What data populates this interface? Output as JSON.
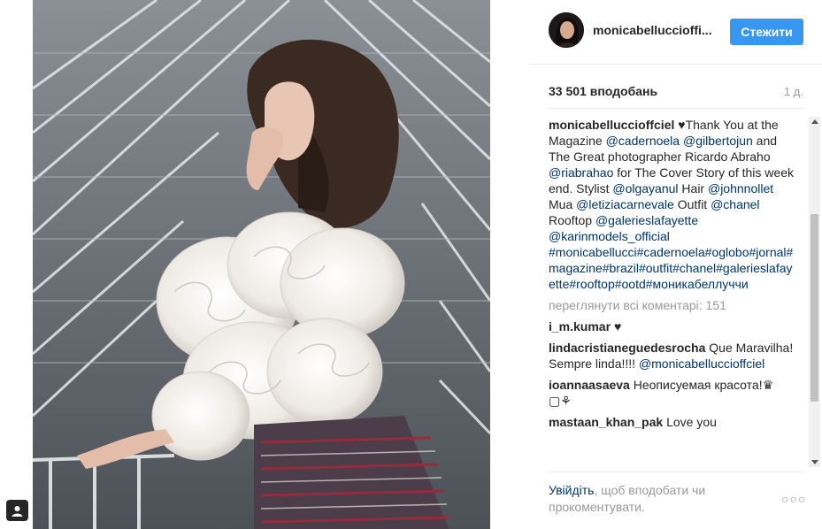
{
  "post": {
    "username": "monicabelluccioffi...",
    "follow_label": "Стежити",
    "likes": "33 501 вподобань",
    "time_ago": "1 д."
  },
  "caption": {
    "author": "monicabelluccioffciel",
    "parts": [
      {
        "t": "♥Thank You at the Magazine ",
        "m": false
      },
      {
        "t": "@cadernoela",
        "m": true
      },
      {
        "t": " ",
        "m": false
      },
      {
        "t": "@gilbertojun",
        "m": true
      },
      {
        "t": " and The Great photographer Ricardo Abraho ",
        "m": false
      },
      {
        "t": "@riabrahao",
        "m": true
      },
      {
        "t": " for The Cover Story of this week end. Stylist ",
        "m": false
      },
      {
        "t": "@olgayanul",
        "m": true
      },
      {
        "t": " Hair ",
        "m": false
      },
      {
        "t": "@johnnollet",
        "m": true
      },
      {
        "t": " Mua ",
        "m": false
      },
      {
        "t": "@letiziacarnevale",
        "m": true
      },
      {
        "t": " Outfit ",
        "m": false
      },
      {
        "t": "@chanel",
        "m": true
      },
      {
        "t": " Rooftop ",
        "m": false
      },
      {
        "t": "@galerieslafayette",
        "m": true
      },
      {
        "t": " ",
        "m": false
      },
      {
        "t": "@karinmodels_official",
        "m": true
      },
      {
        "t": " ",
        "m": false
      },
      {
        "t": "#monicabellucci#cadernoela#oglobo#jornal#magazine#brazil#outfit#chanel#galerieslafayette#rooftop#ootd#моникабеллуччи",
        "m": true
      }
    ]
  },
  "view_all_comments": "переглянути всі коментарі: 151",
  "comments": [
    {
      "user": "i_m.kumar",
      "parts": [
        {
          "t": "♥",
          "m": false
        }
      ]
    },
    {
      "user": "lindacristianeguedesrocha",
      "parts": [
        {
          "t": "Que Maravilha! Sempre linda!!!! ",
          "m": false
        },
        {
          "t": "@monicabelluccioffciel",
          "m": true
        }
      ]
    },
    {
      "user": "ioannaasaeva",
      "parts": [
        {
          "t": "Неописуемая красота!♛ ▢⚘",
          "m": false
        }
      ]
    },
    {
      "user": "mastaan_khan_pak",
      "parts": [
        {
          "t": "Love you",
          "m": false
        }
      ]
    }
  ],
  "footer": {
    "login_link": "Увійдіть",
    "login_rest": ", щоб вподобати чи прокоментувати.",
    "more": "○○○"
  },
  "colors": {
    "follow_button": "#3897f0",
    "link": "#003569",
    "muted": "#999999"
  },
  "icons": [
    "tag-user-icon",
    "more-options-icon",
    "scroll-up-icon",
    "scroll-down-icon"
  ]
}
